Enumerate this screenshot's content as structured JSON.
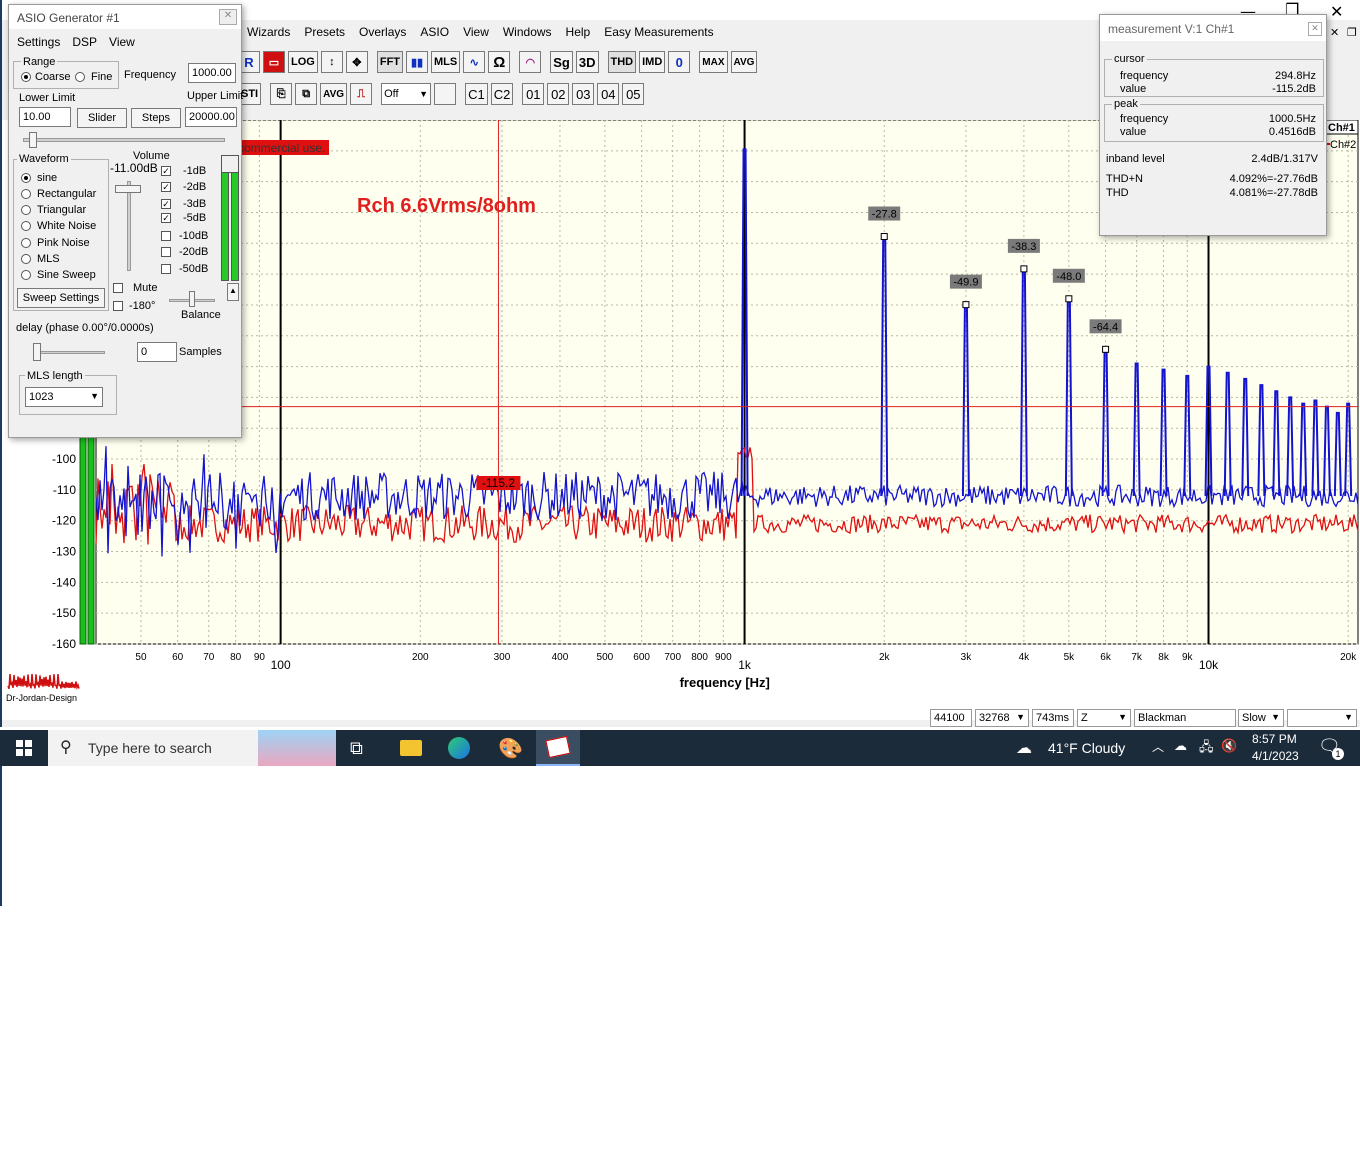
{
  "menubar": [
    "Wizards",
    "Presets",
    "Overlays",
    "ASIO",
    "View",
    "Windows",
    "Help",
    "Easy Measurements"
  ],
  "toolbar_row1": [
    "R",
    "▭",
    "LOG",
    "↕",
    "✥",
    "FFT",
    "▮▮",
    "MLS",
    "∿",
    "Ω",
    "◠",
    "Sg",
    "3D",
    "THD",
    "IMD",
    "0",
    "MAX",
    "AVG"
  ],
  "toolbar_row2": [
    "STI",
    "⎘",
    "⧉",
    "AVG",
    "⎍",
    "Off",
    "C1",
    "C2",
    "01",
    "02",
    "03",
    "04",
    "05"
  ],
  "generator": {
    "title": "ASIO Generator #1",
    "menus": [
      "Settings",
      "DSP",
      "View"
    ],
    "range_label": "Range",
    "coarse": "Coarse",
    "fine": "Fine",
    "frequency_label": "Frequency",
    "frequency_value": "1000.00",
    "lower_limit_label": "Lower Limit",
    "lower_limit_value": "10.00",
    "upper_limit_label": "Upper Limit",
    "upper_limit_value": "20000.00",
    "slider_btn": "Slider",
    "steps_btn": "Steps",
    "waveform_label": "Waveform",
    "waveforms": [
      "sine",
      "Rectangular",
      "Triangular",
      "White Noise",
      "Pink Noise",
      "MLS",
      "Sine Sweep"
    ],
    "volume_label": "Volume",
    "volume_value": "-11.00dB",
    "attenuators": [
      "-1dB",
      "-2dB",
      "-3dB",
      "-5dB",
      "-10dB",
      "-20dB",
      "-50dB"
    ],
    "attenuators_checked": [
      true,
      true,
      true,
      true,
      false,
      false,
      false
    ],
    "sweep_settings": "Sweep Settings",
    "mute": "Mute",
    "invert": "-180°",
    "balance": "Balance",
    "delay_label": "delay (phase  0.00°/0.0000s)",
    "samples_value": "0",
    "samples_label": "Samples",
    "mls_length_label": "MLS length",
    "mls_length_value": "1023"
  },
  "measurement": {
    "title": "measurement V:1 Ch#1",
    "cursor_label": "cursor",
    "peak_label": "peak",
    "frequency_label": "frequency",
    "value_label": "value",
    "cursor_frequency": "294.8Hz",
    "cursor_value": "-115.2dB",
    "peak_frequency": "1000.5Hz",
    "peak_value": "0.4516dB",
    "inband_label": "inband level",
    "inband_value": "2.4dB/1.317V",
    "thdn_label": "THD+N",
    "thdn_value": "4.092%=-27.76dB",
    "thd_label": "THD",
    "thd_value": "4.081%=-27.78dB"
  },
  "chart_annotation": "Rch 6.6Vrms/8ohm",
  "commercial_banner": "commercial use.",
  "cursor_marker": "-115.2",
  "legend": [
    "Ch#1",
    "Ch#2"
  ],
  "logo_text": "Dr-Jordan-Design",
  "statusbar": [
    "44100",
    "32768",
    "743ms",
    "Z",
    "Blackman",
    "Slow",
    ""
  ],
  "taskbar": {
    "search_placeholder": "Type here to search",
    "weather": "41°F  Cloudy",
    "time": "8:57 PM",
    "date": "4/1/2023",
    "notification_count": "1"
  },
  "colors": {
    "ch1": "#1414d0",
    "ch2": "#e01010",
    "plot_bg": "#fffff0",
    "grid": "#b8b8a0"
  },
  "chart_data": {
    "type": "line",
    "xlabel": "frequency [Hz]",
    "ylabel": "",
    "xscale": "log",
    "xlim": [
      40,
      21000
    ],
    "ylim": [
      -160,
      10
    ],
    "y_ticks": [
      "-100",
      "-110",
      "-120",
      "-130",
      "-140",
      "-150",
      "-160"
    ],
    "x_ticks": [
      "50",
      "60",
      "70",
      "80",
      "90",
      "100",
      "200",
      "300",
      "400",
      "500",
      "600",
      "700",
      "800",
      "900",
      "1k",
      "2k",
      "3k",
      "4k",
      "5k",
      "6k",
      "7k",
      "8k",
      "9k",
      "10k",
      "20k"
    ],
    "x_tick_values": [
      50,
      60,
      70,
      80,
      90,
      100,
      200,
      300,
      400,
      500,
      600,
      700,
      800,
      900,
      1000,
      2000,
      3000,
      4000,
      5000,
      6000,
      7000,
      8000,
      9000,
      10000,
      20000
    ],
    "major_x_ticks": [
      100,
      1000,
      10000
    ],
    "cursor_x": 294.8,
    "reference_y": -83,
    "series": [
      {
        "name": "Ch#1",
        "floor": -112,
        "harmonics": [
          {
            "x": 1000,
            "y": 0.45
          },
          {
            "x": 2000,
            "y": -27.8
          },
          {
            "x": 3000,
            "y": -49.9
          },
          {
            "x": 4000,
            "y": -38.3
          },
          {
            "x": 5000,
            "y": -48.0
          },
          {
            "x": 6000,
            "y": -64.4
          },
          {
            "x": 7000,
            "y": -69
          },
          {
            "x": 8000,
            "y": -71
          },
          {
            "x": 9000,
            "y": -73
          },
          {
            "x": 10000,
            "y": -70
          },
          {
            "x": 11000,
            "y": -72
          },
          {
            "x": 12000,
            "y": -74
          },
          {
            "x": 13000,
            "y": -76
          },
          {
            "x": 14000,
            "y": -78
          },
          {
            "x": 15000,
            "y": -80
          },
          {
            "x": 16000,
            "y": -82
          },
          {
            "x": 17000,
            "y": -81
          },
          {
            "x": 18000,
            "y": -83
          },
          {
            "x": 19000,
            "y": -85
          },
          {
            "x": 20000,
            "y": -82
          }
        ]
      },
      {
        "name": "Ch#2",
        "floor": -121
      }
    ],
    "peak_labels": [
      {
        "x": 2000,
        "y": -27.8,
        "text": "-27.8"
      },
      {
        "x": 3000,
        "y": -49.9,
        "text": "-49.9"
      },
      {
        "x": 4000,
        "y": -38.3,
        "text": "-38.3"
      },
      {
        "x": 5000,
        "y": -48.0,
        "text": "-48.0"
      },
      {
        "x": 6000,
        "y": -64.4,
        "text": "-64.4"
      }
    ]
  }
}
